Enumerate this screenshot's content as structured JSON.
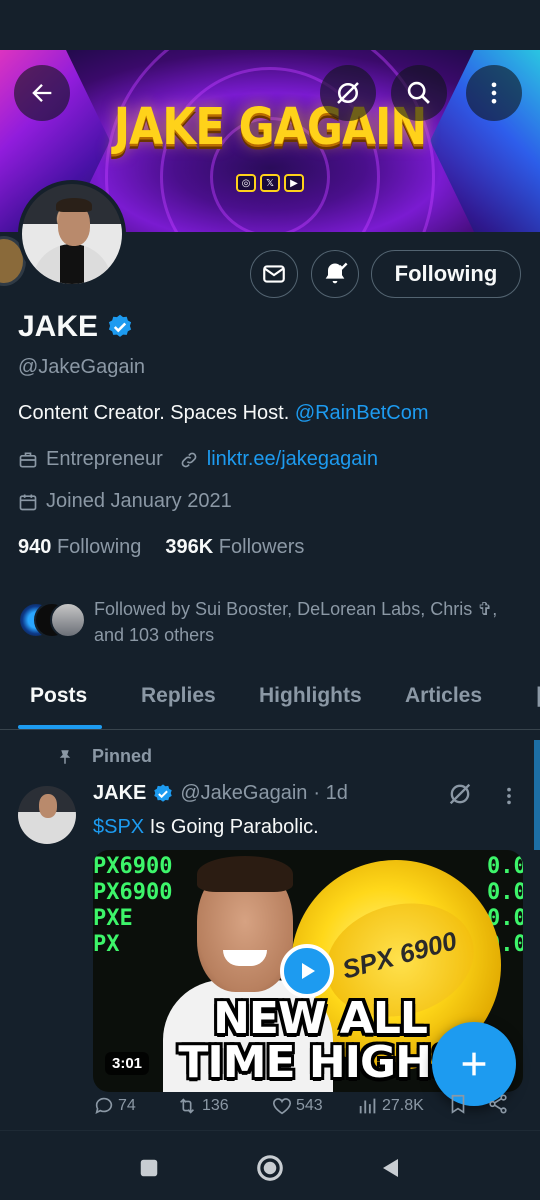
{
  "banner": {
    "title": "JAKE GAGAIN",
    "socials": [
      "instagram-icon",
      "x-icon",
      "youtube-icon"
    ]
  },
  "profile": {
    "name": "JAKE",
    "handle": "@JakeGagain",
    "bio_text": "Content Creator. Spaces Host. ",
    "bio_link": "@RainBetCom",
    "category": "Entrepreneur",
    "website": "linktr.ee/jakegagain",
    "joined": "Joined January 2021",
    "following_count": "940",
    "following_label": "Following",
    "followers_count": "396K",
    "followers_label": "Followers",
    "followed_by": "Followed by Sui Booster, DeLorean Labs, Chris ✞, and 103 others"
  },
  "actions": {
    "follow_label": "Following"
  },
  "tabs": [
    {
      "label": "Posts",
      "active": true
    },
    {
      "label": "Replies",
      "active": false
    },
    {
      "label": "Highlights",
      "active": false
    },
    {
      "label": "Articles",
      "active": false
    }
  ],
  "tweet": {
    "pinned_label": "Pinned",
    "name": "JAKE",
    "handle": "@JakeGagain",
    "time": "· 1d",
    "cashtag": "$SPX",
    "text": " Is Going Parabolic.",
    "media": {
      "ticker_left": [
        "PX6900",
        "PX6900",
        "PXE",
        "PX"
      ],
      "ticker_right": [
        "0.0",
        "0.0",
        "0.0",
        "0.0"
      ],
      "coin_text": "SPX 6900",
      "headline_1": "NEW ALL",
      "headline_2": "TIME HIGHS",
      "duration": "3:01"
    },
    "replies": "74",
    "retweets": "136",
    "likes": "543",
    "views": "27.8K"
  },
  "colors": {
    "background": "#15202b",
    "accent": "#1d9bf0",
    "secondary_text": "#8b98a5",
    "verified": "#1d9bf0"
  }
}
